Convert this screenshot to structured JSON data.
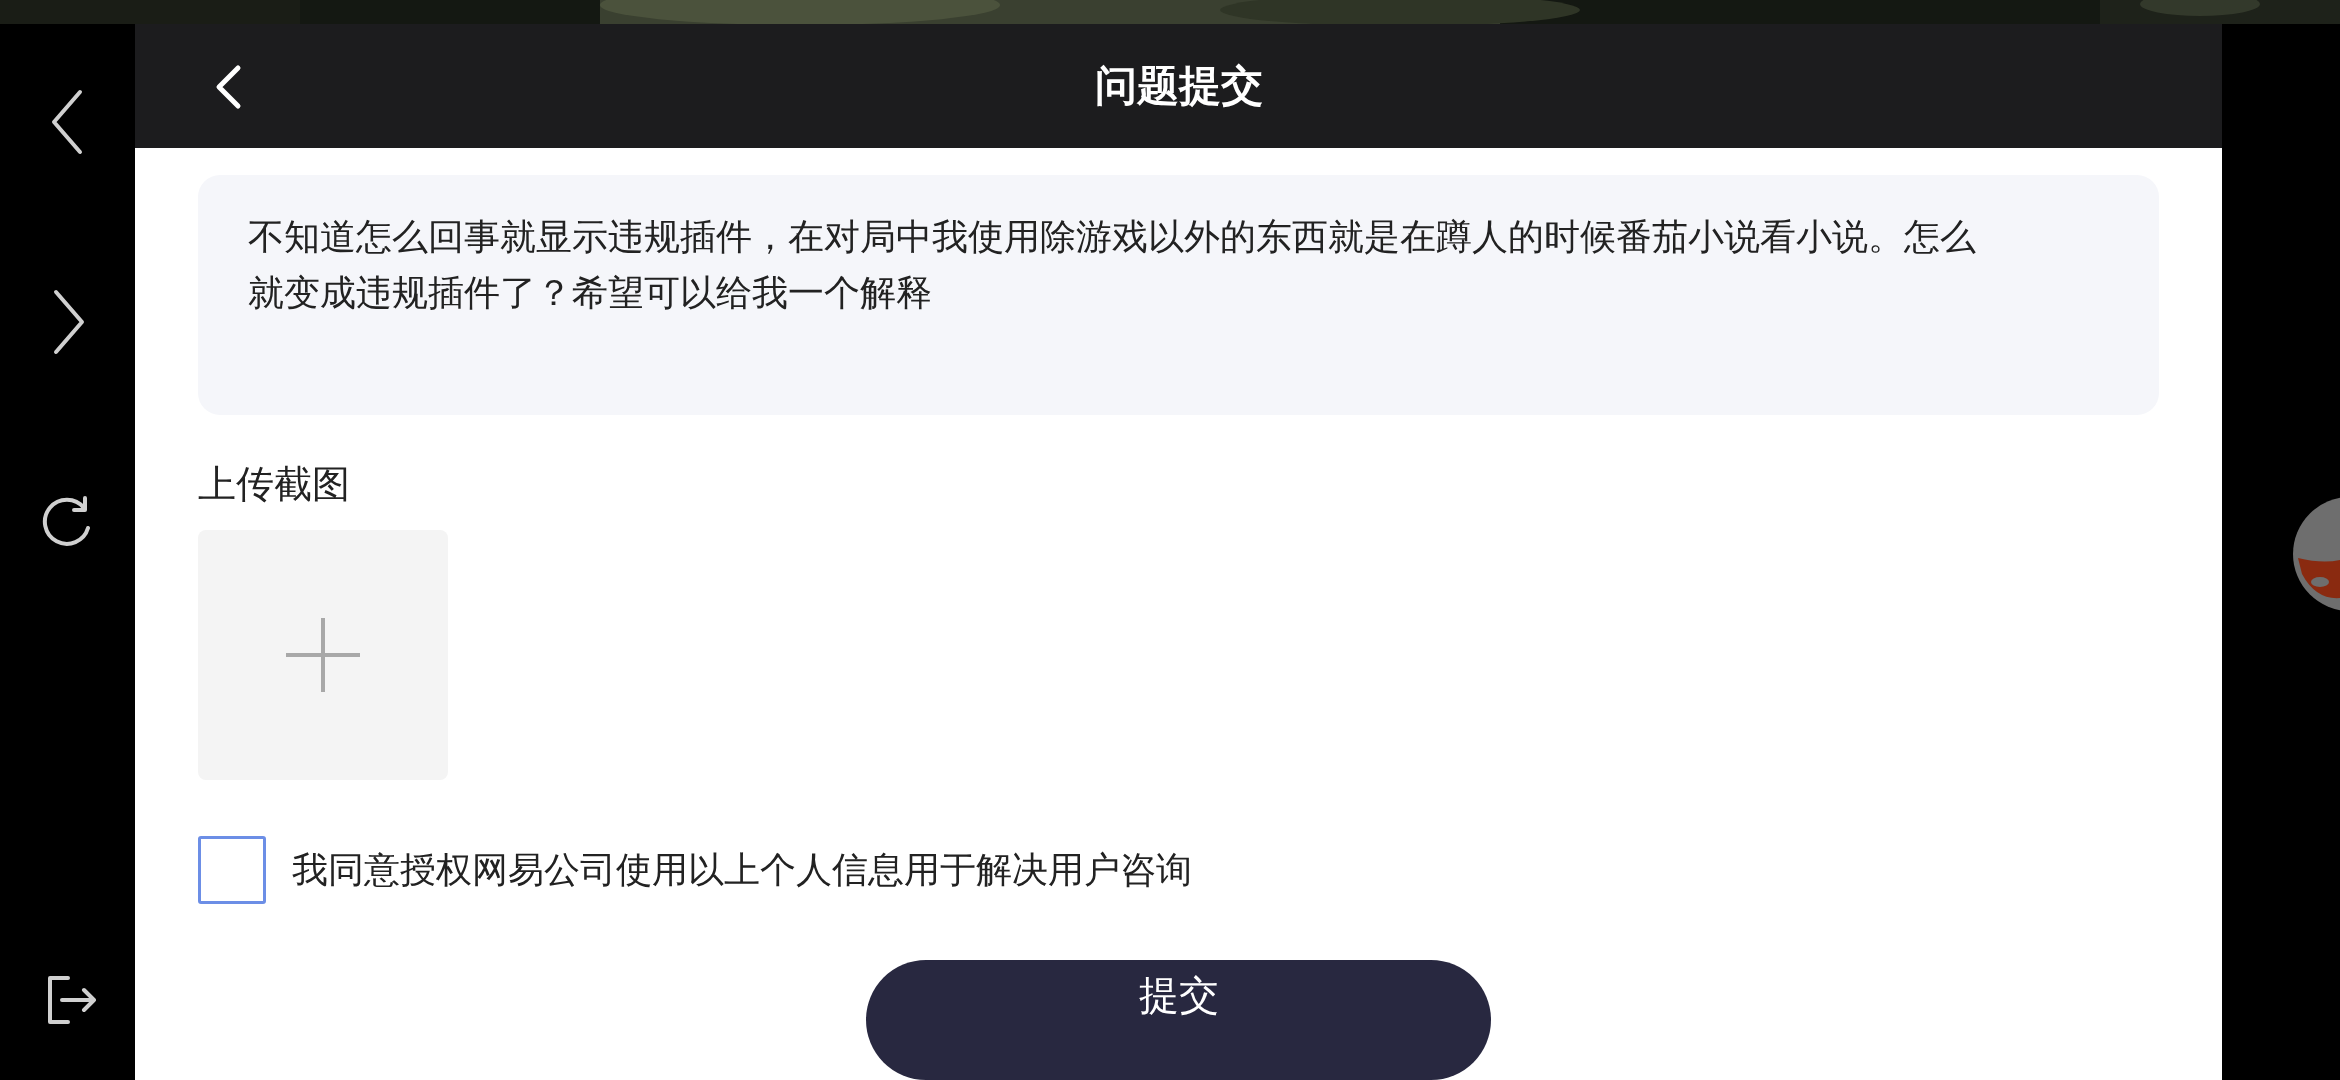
{
  "nav": [
    {
      "kind": "back"
    },
    {
      "kind": "forward"
    },
    {
      "kind": "refresh"
    },
    {
      "kind": "exit"
    }
  ],
  "header": {
    "title": "问题提交"
  },
  "description": {
    "value": "不知道怎么回事就显示违规插件，在对局中我使用除游戏以外的东西就是在蹲人的时候番茄小说看小说。怎么就变成违规插件了？希望可以给我一个解释"
  },
  "upload": {
    "label": "上传截图"
  },
  "consent": {
    "label": "我同意授权网易公司使用以上个人信息用于解决用户咨询",
    "checked": false
  },
  "submit": {
    "label": "提交"
  }
}
